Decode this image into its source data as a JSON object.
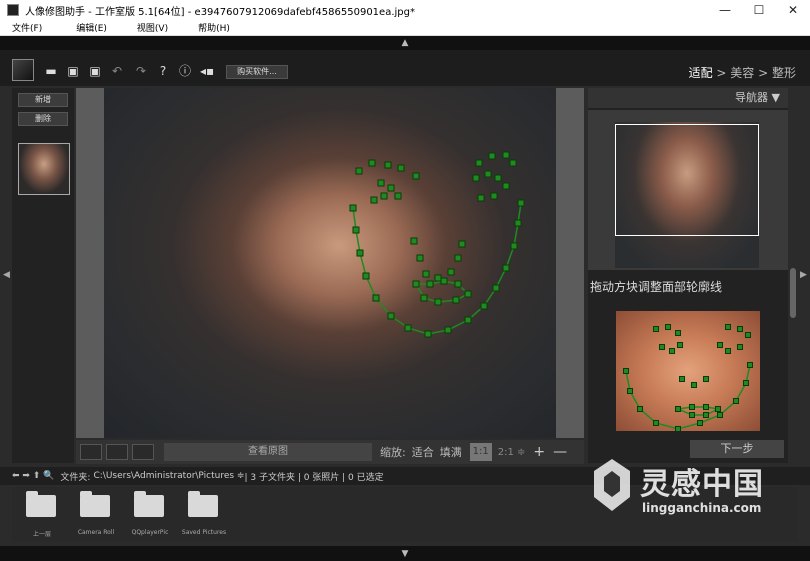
{
  "window": {
    "title": "人像修图助手 - 工作室版 5.1[64位] - e3947607912069dafebf4586550901ea.jpg*",
    "minimize": "—",
    "maximize": "☐",
    "close": "✕"
  },
  "menu": [
    "文件(F)",
    "编辑(E)",
    "视图(V)",
    "帮助(H)"
  ],
  "toolbar": {
    "buy_label": "购买软件...",
    "steps": {
      "step1": "适配",
      "sep1": " > ",
      "step2": "美容",
      "sep2": " > ",
      "step3": "整形"
    }
  },
  "left_panel": {
    "new_label": "新增",
    "delete_label": "删除"
  },
  "canvas_bar": {
    "view_original": "查看原图",
    "zoom_label": "缩放:",
    "fit": "适合",
    "fill": "填满",
    "zoom_1_1": "1:1",
    "zoom_2_1": "2:1 ≑",
    "zoom_in": "+",
    "zoom_out": "—"
  },
  "right_panel": {
    "navigator_label": "导航器 ▼",
    "hint": "拖动方块调整面部轮廓线",
    "next_label": "下一步"
  },
  "pathbar": {
    "arrows": "⬅ ➡ ⬆ 🔍",
    "label": "文件夹:",
    "path": "C:\\Users\\Administrator\\Pictures ≑",
    "info": " | 3 子文件夹 | 0 张照片 | 0 已选定"
  },
  "folders": [
    {
      "label": "上一层"
    },
    {
      "label": "Camera Roll"
    },
    {
      "label": "QQplayerPic"
    },
    {
      "label": "Saved Pictures"
    }
  ],
  "watermark": {
    "cn": "灵感中国",
    "en": "lingganchina.com"
  },
  "colors": {
    "landmark": "#1f8a1f",
    "landmark_border": "#0a3a0a"
  }
}
